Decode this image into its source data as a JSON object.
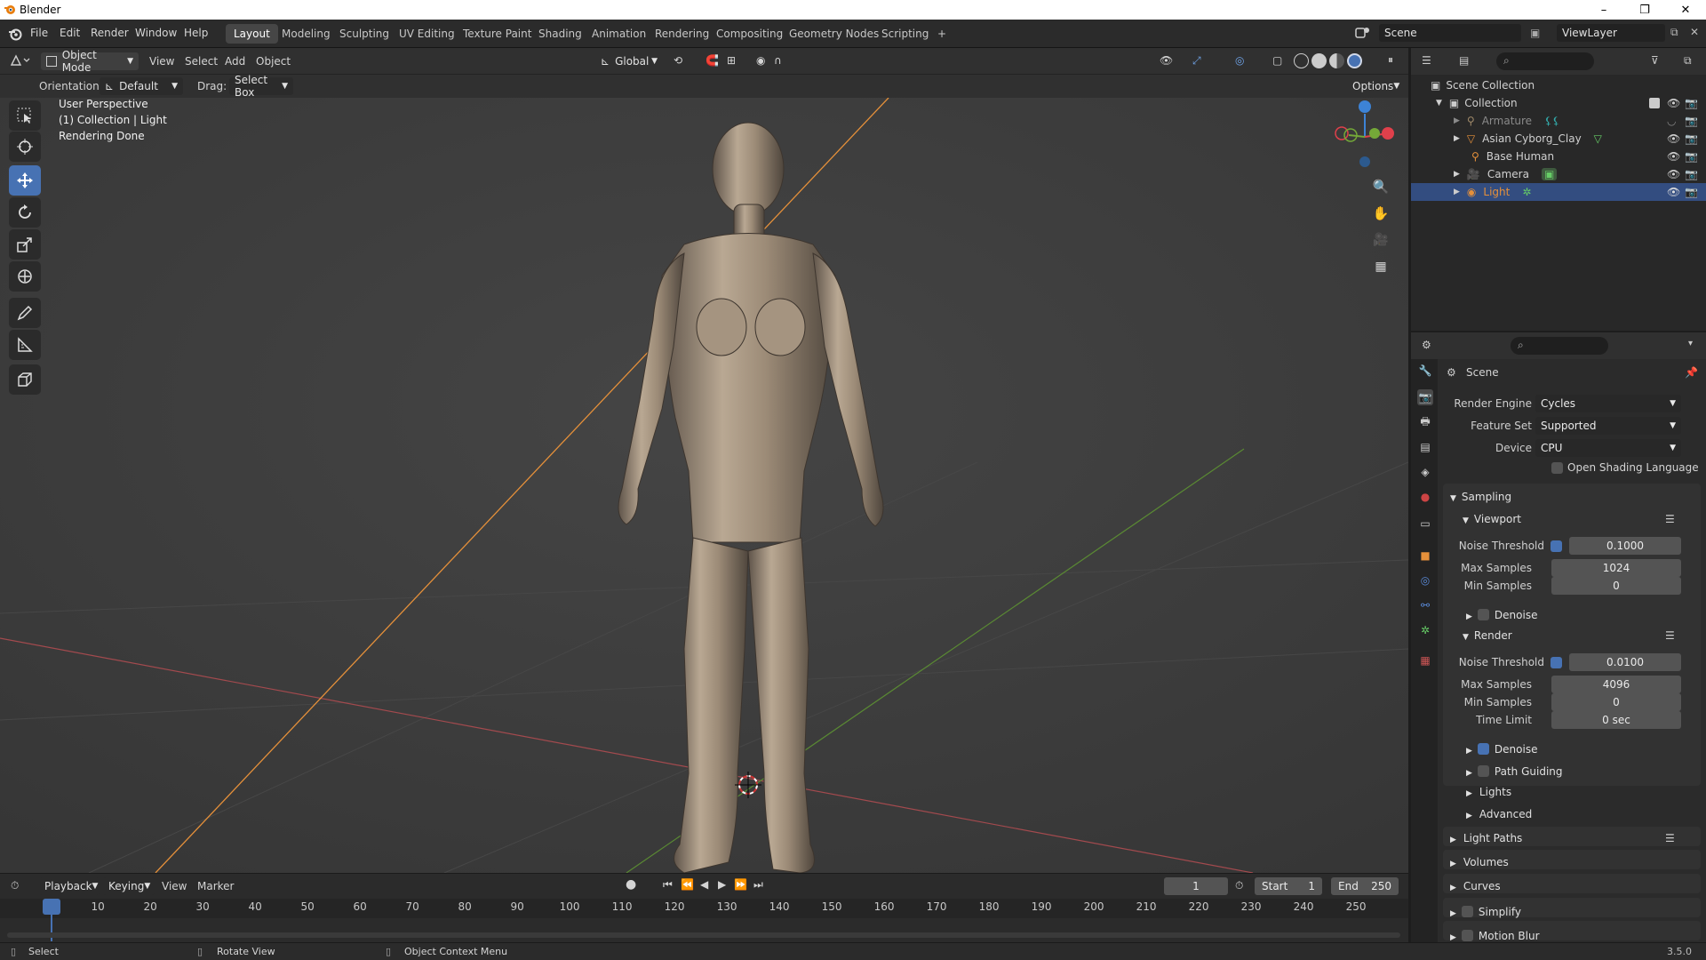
{
  "window": {
    "title": "Blender"
  },
  "menu": [
    "File",
    "Edit",
    "Render",
    "Window",
    "Help"
  ],
  "workspaces": [
    "Layout",
    "Modeling",
    "Sculpting",
    "UV Editing",
    "Texture Paint",
    "Shading",
    "Animation",
    "Rendering",
    "Compositing",
    "Geometry Nodes",
    "Scripting",
    "+"
  ],
  "scene_selector": {
    "scene": "Scene",
    "view_layer": "ViewLayer"
  },
  "viewport_header": {
    "mode": "Object Mode",
    "menus": [
      "View",
      "Select",
      "Add",
      "Object"
    ],
    "transform_orientation": "Global",
    "orientation_label": "Orientation:",
    "orientation_value": "Default",
    "drag_label": "Drag:",
    "drag_value": "Select Box",
    "options": "Options"
  },
  "viewport_overlay": {
    "line1": "User Perspective",
    "line2": "(1) Collection | Light",
    "line3": "Rendering Done"
  },
  "outliner": {
    "root": "Scene Collection",
    "collection": "Collection",
    "items": [
      {
        "name": "Armature",
        "dim": true
      },
      {
        "name": "Asian Cyborg_Clay",
        "dim": false
      },
      {
        "name": "Base Human",
        "dim": false
      },
      {
        "name": "Camera",
        "dim": false
      },
      {
        "name": "Light",
        "dim": false,
        "selected": true
      }
    ]
  },
  "properties": {
    "context": "Scene",
    "render_engine_label": "Render Engine",
    "render_engine": "Cycles",
    "feature_set_label": "Feature Set",
    "feature_set": "Supported",
    "device_label": "Device",
    "device": "CPU",
    "osl_label": "Open Shading Language",
    "sampling": "Sampling",
    "viewport": "Viewport",
    "noise_threshold_label": "Noise Threshold",
    "viewport_noise_threshold": "0.1000",
    "max_samples_label": "Max Samples",
    "viewport_max_samples": "1024",
    "min_samples_label": "Min Samples",
    "viewport_min_samples": "0",
    "denoise_label": "Denoise",
    "render": "Render",
    "render_noise_threshold": "0.0100",
    "render_max_samples": "4096",
    "render_min_samples": "0",
    "time_limit_label": "Time Limit",
    "time_limit": "0 sec",
    "path_guiding": "Path Guiding",
    "lights": "Lights",
    "advanced": "Advanced",
    "light_paths": "Light Paths",
    "volumes": "Volumes",
    "curves": "Curves",
    "simplify": "Simplify",
    "motion_blur": "Motion Blur"
  },
  "timeline": {
    "menus": [
      "Playback",
      "Keying",
      "View",
      "Marker"
    ],
    "current_frame": "1",
    "start_label": "Start",
    "start": "1",
    "end_label": "End",
    "end": "250",
    "ticks": [
      "1",
      "10",
      "20",
      "30",
      "40",
      "50",
      "60",
      "70",
      "80",
      "90",
      "100",
      "110",
      "120",
      "130",
      "140",
      "150",
      "160",
      "170",
      "180",
      "190",
      "200",
      "210",
      "220",
      "230",
      "240",
      "250"
    ]
  },
  "statusbar": {
    "select": "Select",
    "rotate": "Rotate View",
    "context_menu": "Object Context Menu",
    "version": "3.5.0"
  },
  "colors": {
    "accent": "#4772b3",
    "x_axis": "#e0404b",
    "y_axis": "#74a838",
    "z_axis": "#3d83d6",
    "light_orange": "#e5903a"
  }
}
